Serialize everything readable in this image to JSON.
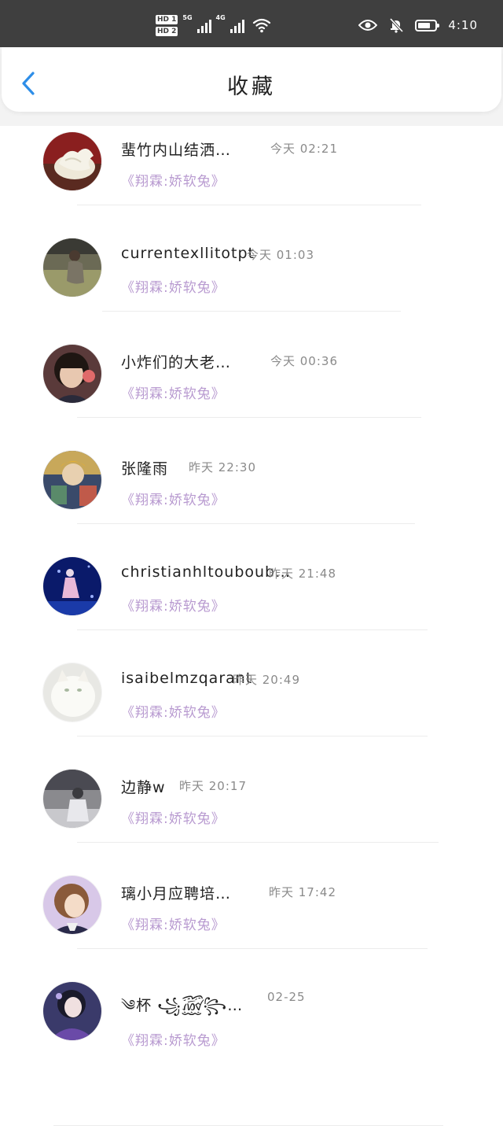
{
  "status_bar": {
    "hd1": "HD 1",
    "hd2": "HD 2",
    "net1": "5G",
    "net2": "4G",
    "time": "4:10"
  },
  "header": {
    "title": "收藏",
    "back_icon": "chevron-left-icon",
    "accent": "#2e8ee8"
  },
  "favorites": [
    {
      "name": "蜚竹内山结洒…",
      "date": "今天 02:21",
      "subtitle": "《翔霖:娇软兔》"
    },
    {
      "name": "currentexllitotpt",
      "date": "今天 01:03",
      "subtitle": "《翔霖:娇软兔》"
    },
    {
      "name": "小炸们的大老…",
      "date": "今天 00:36",
      "subtitle": "《翔霖:娇软兔》"
    },
    {
      "name": "张隆雨",
      "date": "昨天 22:30",
      "subtitle": "《翔霖:娇软兔》"
    },
    {
      "name": "christianhltouboub…",
      "date": "昨天 21:48",
      "subtitle": "《翔霖:娇软兔》"
    },
    {
      "name": "isaibelmzqarant",
      "date": "昨天 20:49",
      "subtitle": "《翔霖:娇软兔》"
    },
    {
      "name": "边静w",
      "date": "昨天 20:17",
      "subtitle": "《翔霖:娇软兔》"
    },
    {
      "name": "璃小月应聘培…",
      "date": "昨天 17:42",
      "subtitle": "《翔霖:娇软兔》"
    },
    {
      "name": "༄杯 ꧁꫞꧂…",
      "date": "02-25",
      "subtitle": "《翔霖:娇软兔》"
    }
  ],
  "colors": {
    "subtitle": "#b89ad0",
    "status_bar_bg": "#3f3f3f"
  }
}
